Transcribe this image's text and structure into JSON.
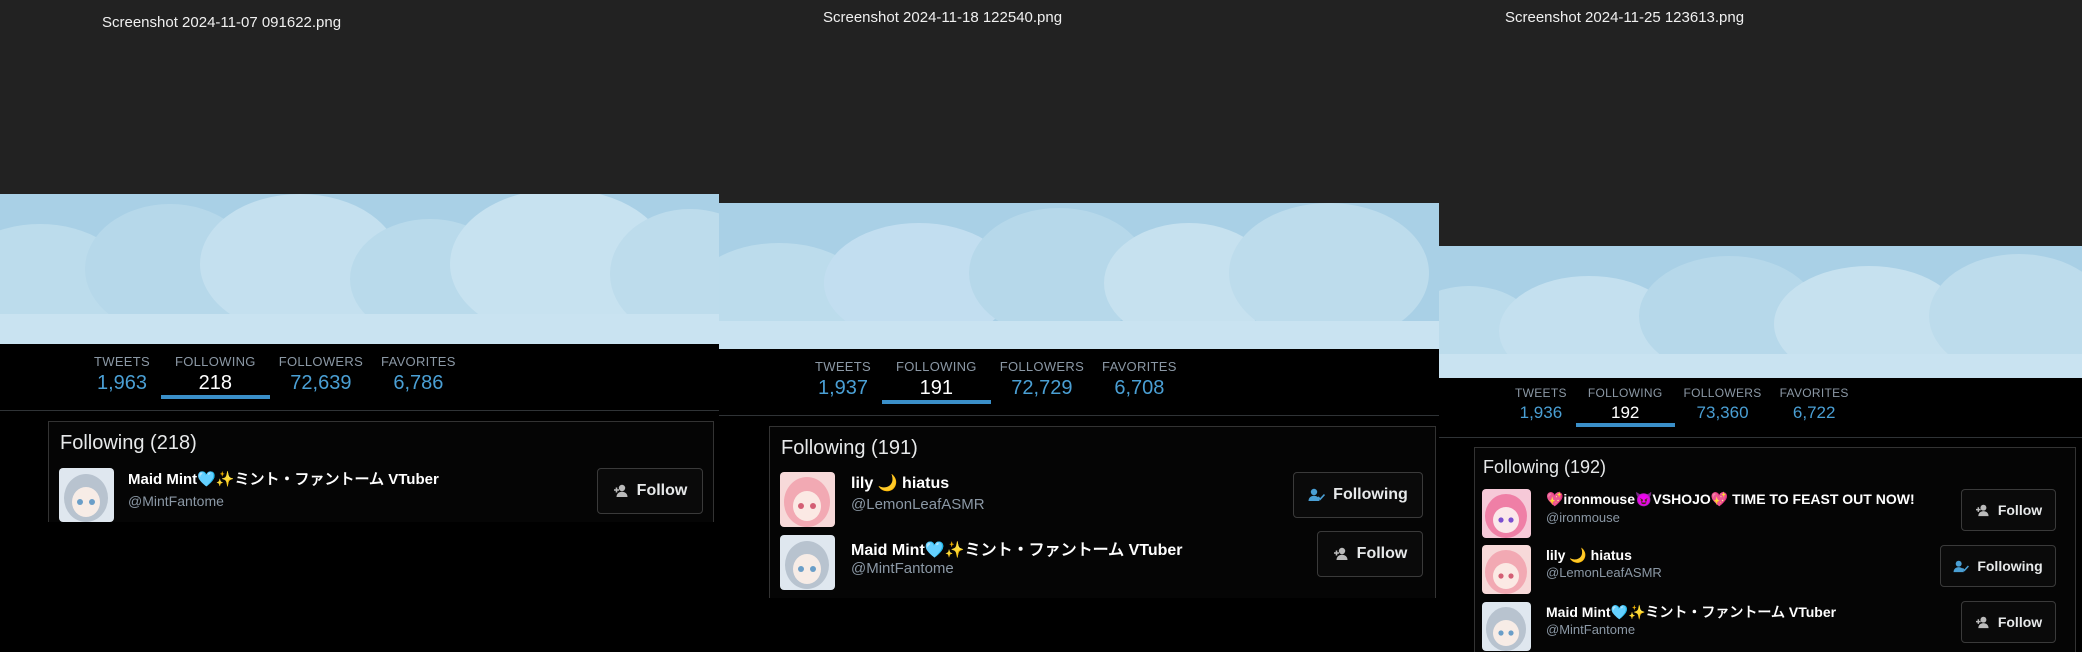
{
  "panels": [
    {
      "file_title": "Screenshot 2024-11-07 091622.png",
      "stats": [
        {
          "label": "TWEETS",
          "value": "1,963"
        },
        {
          "label": "FOLLOWING",
          "value": "218"
        },
        {
          "label": "FOLLOWERS",
          "value": "72,639"
        },
        {
          "label": "FAVORITES",
          "value": "6,786"
        }
      ],
      "section_title": "Following (218)",
      "users": [
        {
          "name": "Maid Mint🩵✨ミント・ファントーム VTuber",
          "handle": "@MintFantome",
          "button": "Follow"
        }
      ]
    },
    {
      "file_title": "Screenshot 2024-11-18 122540.png",
      "stats": [
        {
          "label": "TWEETS",
          "value": "1,937"
        },
        {
          "label": "FOLLOWING",
          "value": "191"
        },
        {
          "label": "FOLLOWERS",
          "value": "72,729"
        },
        {
          "label": "FAVORITES",
          "value": "6,708"
        }
      ],
      "section_title": "Following (191)",
      "users": [
        {
          "name": "lily 🌙 hiatus",
          "handle": "@LemonLeafASMR",
          "button": "Following"
        },
        {
          "name": "Maid Mint🩵✨ミント・ファントーム VTuber",
          "handle": "@MintFantome",
          "button": "Follow"
        }
      ]
    },
    {
      "file_title": "Screenshot 2024-11-25 123613.png",
      "stats": [
        {
          "label": "TWEETS",
          "value": "1,936"
        },
        {
          "label": "FOLLOWING",
          "value": "192"
        },
        {
          "label": "FOLLOWERS",
          "value": "73,360"
        },
        {
          "label": "FAVORITES",
          "value": "6,722"
        }
      ],
      "section_title": "Following (192)",
      "users": [
        {
          "name": "💖ironmouse😈VSHOJO💖 TIME TO FEAST OUT NOW!",
          "handle": "@ironmouse",
          "button": "Follow"
        },
        {
          "name": "lily 🌙 hiatus",
          "handle": "@LemonLeafASMR",
          "button": "Following"
        },
        {
          "name": "Maid Mint🩵✨ミント・ファントーム VTuber",
          "handle": "@MintFantome",
          "button": "Follow"
        }
      ]
    }
  ],
  "colors": {
    "accent": "#4a9fd4",
    "titlebar": "#222222",
    "banner_sky": "#b9d9ea",
    "background": "#000000"
  },
  "icons": [
    "follow-icon",
    "following-icon"
  ]
}
